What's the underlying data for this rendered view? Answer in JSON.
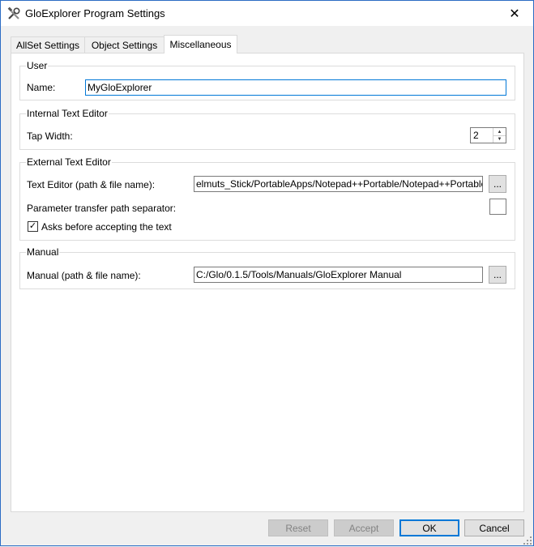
{
  "window": {
    "title": "GloExplorer Program Settings",
    "close_glyph": "✕"
  },
  "tabs": [
    {
      "label": "AllSet Settings"
    },
    {
      "label": "Object Settings"
    },
    {
      "label": "Miscellaneous"
    }
  ],
  "user": {
    "title": "User",
    "name_label": "Name:",
    "name_value": "MyGloExplorer"
  },
  "internal_editor": {
    "title": "Internal Text Editor",
    "tab_width_label": "Tap Width:",
    "tab_width_value": "2"
  },
  "external_editor": {
    "title": "External Text Editor",
    "path_label": "Text Editor (path & file name):",
    "path_value": "elmuts_Stick/PortableApps/Notepad++Portable/Notepad++Portable.exe",
    "browse_label": "...",
    "separator_label": "Parameter transfer path separator:",
    "separator_value": "",
    "ask_label": "Asks before accepting the text",
    "ask_checked": "✓"
  },
  "manual": {
    "title": "Manual",
    "path_label": "Manual (path & file name):",
    "path_value": "C:/Glo/0.1.5/Tools/Manuals/GloExplorer Manual",
    "browse_label": "..."
  },
  "buttons": {
    "reset": "Reset",
    "accept": "Accept",
    "ok": "OK",
    "cancel": "Cancel"
  },
  "colors": {
    "focus": "#0078d7",
    "disabled_bg": "#cccccc"
  }
}
